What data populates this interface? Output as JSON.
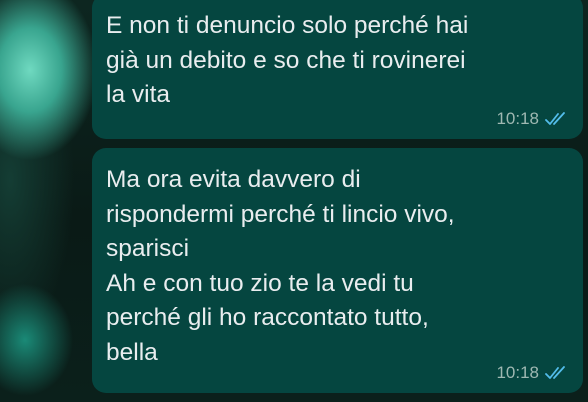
{
  "messages": [
    {
      "text": "E non ti denuncio solo perché hai\ngià un debito e so che ti rovinerei\nla vita",
      "time": "10:18",
      "status_icon": "double-check-read-icon"
    },
    {
      "text": "Ma ora evita davvero di\nrispondermi perché ti lincio vivo,\nsparisci\nAh e con tuo zio te la vedi tu\nperché gli ho raccontato tutto,\nbella",
      "time": "10:18",
      "status_icon": "double-check-read-icon"
    }
  ],
  "colors": {
    "bubble_outgoing": "#054640",
    "text": "#e9edef",
    "timestamp": "#9fb8b2",
    "read_ticks": "#53bdeb"
  }
}
